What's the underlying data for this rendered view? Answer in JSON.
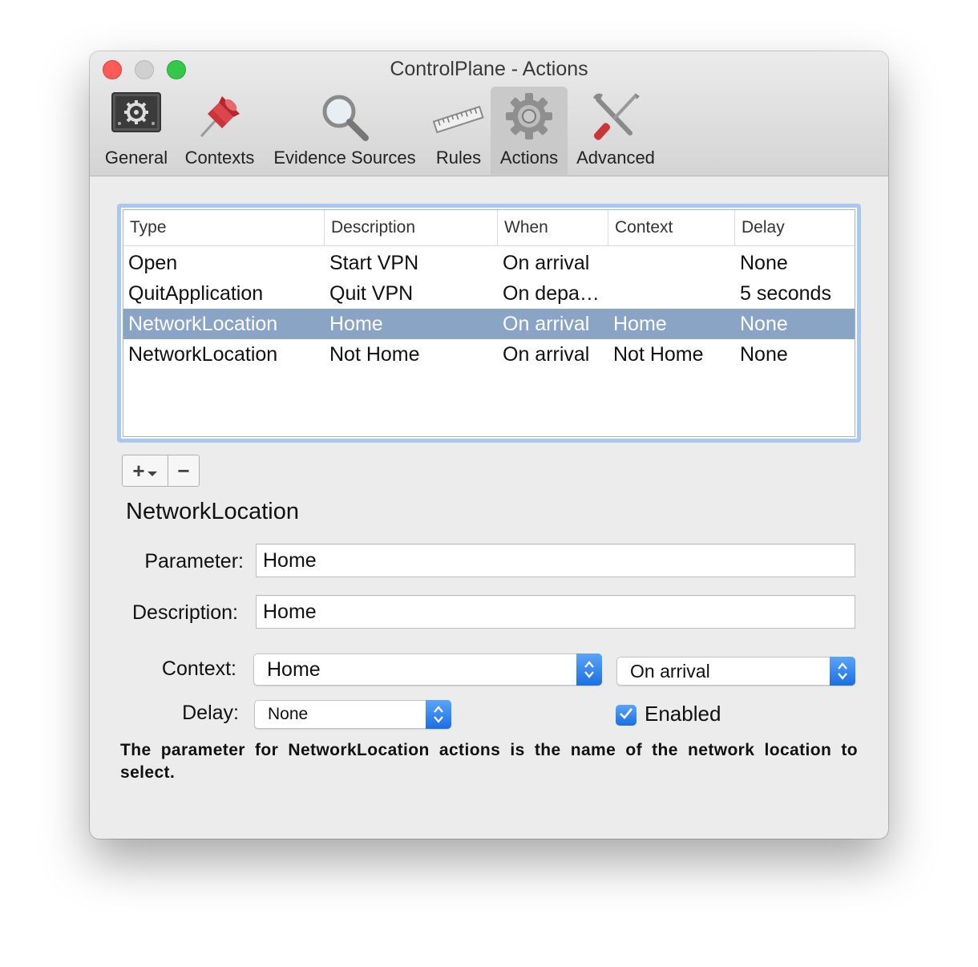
{
  "window": {
    "title": "ControlPlane - Actions"
  },
  "toolbar": {
    "tabs": [
      {
        "label": "General",
        "icon": "general-settings-icon"
      },
      {
        "label": "Contexts",
        "icon": "pushpin-icon"
      },
      {
        "label": "Evidence Sources",
        "icon": "magnifier-icon"
      },
      {
        "label": "Rules",
        "icon": "ruler-icon"
      },
      {
        "label": "Actions",
        "icon": "gear-icon"
      },
      {
        "label": "Advanced",
        "icon": "tools-icon"
      }
    ],
    "active": "Actions"
  },
  "table": {
    "columns": [
      "Type",
      "Description",
      "When",
      "Context",
      "Delay"
    ],
    "rows": [
      {
        "type": "Open",
        "description": "Start VPN",
        "when": "On arrival",
        "context": "",
        "delay": "None"
      },
      {
        "type": "QuitApplication",
        "description": "Quit VPN",
        "when": "On depa…",
        "context": "",
        "delay": "5 seconds"
      },
      {
        "type": "NetworkLocation",
        "description": "Home",
        "when": "On arrival",
        "context": "Home",
        "delay": "None"
      },
      {
        "type": "NetworkLocation",
        "description": "Not Home",
        "when": "On arrival",
        "context": "Not Home",
        "delay": "None"
      }
    ],
    "selected_row": 2
  },
  "buttons": {
    "add": "+",
    "remove": "−"
  },
  "detail": {
    "title": "NetworkLocation",
    "parameter_label": "Parameter:",
    "parameter_value": "Home",
    "description_label": "Description:",
    "description_value": "Home",
    "context_label": "Context:",
    "context_value": "Home",
    "when_value": "On arrival",
    "delay_label": "Delay:",
    "delay_value": "None",
    "enabled_label": "Enabled",
    "enabled": true,
    "help_text": "The parameter for NetworkLocation actions is the name of the network location to select."
  },
  "colors": {
    "selection": "#8aa4c6",
    "accent": "#1b6fe3",
    "focus_ring": "#a9c7ef"
  }
}
